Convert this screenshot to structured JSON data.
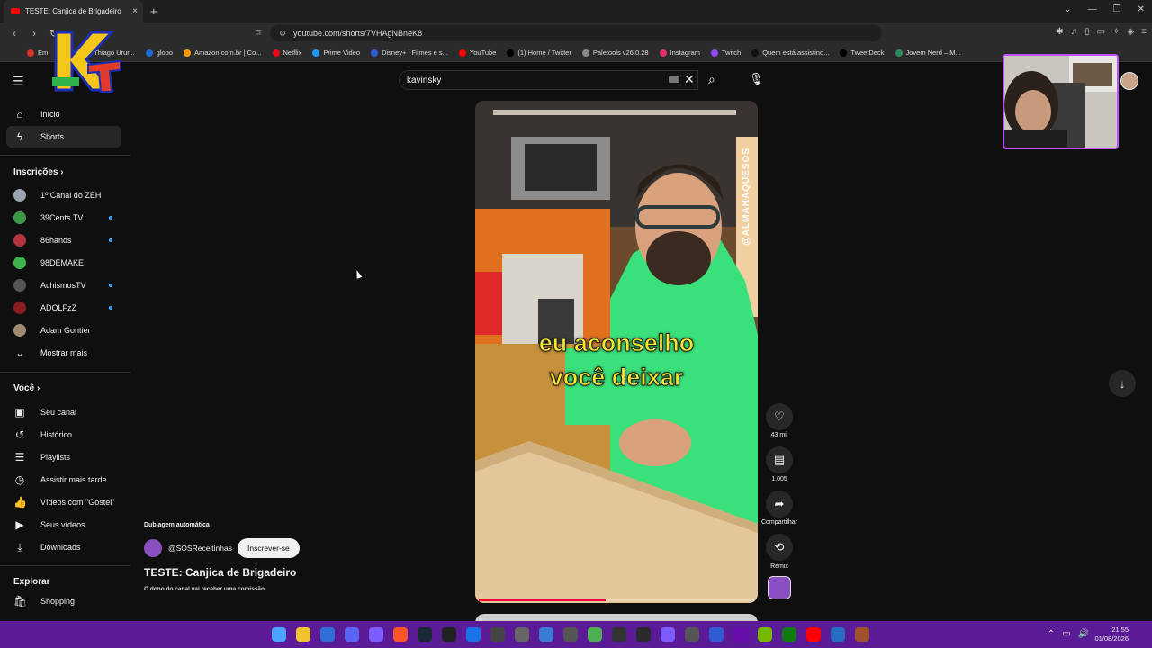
{
  "browser": {
    "tab_title": "TESTE: Canjica de Brigadeiro",
    "tab_close": "×",
    "new_tab": "+",
    "url": "youtube.com/shorts/7VHAgNBneK8",
    "bookmarks": [
      {
        "label": "Em",
        "color": "#d93025"
      },
      {
        "label": "Email – Thiago Urur...",
        "color": "#4285f4"
      },
      {
        "label": "globo",
        "color": "#1e6bd6"
      },
      {
        "label": "Amazon.com.br | Co...",
        "color": "#ff9900"
      },
      {
        "label": "Netflix",
        "color": "#e50914"
      },
      {
        "label": "Prime Video",
        "color": "#1a98ff"
      },
      {
        "label": "Disney+ | Filmes e s...",
        "color": "#2f5bd6"
      },
      {
        "label": "YouTube",
        "color": "#ff0000"
      },
      {
        "label": "(1) Home / Twitter",
        "color": "#000000"
      },
      {
        "label": "Paletools v26.0.28",
        "color": "#888888"
      },
      {
        "label": "Instagram",
        "color": "#e1306c"
      },
      {
        "label": "Twitch",
        "color": "#9146ff"
      },
      {
        "label": "Quem está assistind...",
        "color": "#111111"
      },
      {
        "label": "TweetDeck",
        "color": "#000000"
      },
      {
        "label": "Jovem Nerd – M...",
        "color": "#2d8a5e"
      }
    ]
  },
  "search": {
    "query": "kavinsky"
  },
  "sidebar": {
    "main": [
      {
        "label": "Início",
        "icon": "home-icon",
        "glyph": "⌂"
      },
      {
        "label": "Shorts",
        "icon": "shorts-icon",
        "glyph": "ϟ"
      }
    ],
    "subscriptions_title": "Inscrições",
    "subscriptions": [
      {
        "label": "1º Canal do ZEH",
        "color": "#9aa3ad",
        "new": false
      },
      {
        "label": "39Cents TV",
        "color": "#3c9a45",
        "new": true
      },
      {
        "label": "86hands",
        "color": "#b4343c",
        "new": true
      },
      {
        "label": "98DEMAKE",
        "color": "#39b54a",
        "new": false
      },
      {
        "label": "AchismosTV",
        "color": "#555555",
        "new": true
      },
      {
        "label": "ADOLFzZ",
        "color": "#8b1d22",
        "new": true
      },
      {
        "label": "Adam Gontier",
        "color": "#a08a70",
        "new": false
      }
    ],
    "show_more": "Mostrar mais",
    "you_title": "Você",
    "you": [
      {
        "label": "Seu canal",
        "icon": "channel-icon",
        "glyph": "▣"
      },
      {
        "label": "Histórico",
        "icon": "history-icon",
        "glyph": "↺"
      },
      {
        "label": "Playlists",
        "icon": "playlist-icon",
        "glyph": "☰"
      },
      {
        "label": "Assistir mais tarde",
        "icon": "watch-later-icon",
        "glyph": "◷"
      },
      {
        "label": "Vídeos com \"Gostei\"",
        "icon": "like-icon",
        "glyph": "👍"
      },
      {
        "label": "Seus vídeos",
        "icon": "your-videos-icon",
        "glyph": "▶"
      },
      {
        "label": "Downloads",
        "icon": "download-icon",
        "glyph": "⤓"
      }
    ],
    "explore_title": "Explorar",
    "explore": [
      {
        "label": "Shopping",
        "icon": "shopping-icon",
        "glyph": "🛍"
      }
    ]
  },
  "short": {
    "caption_line1": "eu aconselho",
    "caption_line2": "você deixar",
    "watermark": "@ALMANAQUESOS",
    "progress": 0.46,
    "dub_label": "Dublagem automática",
    "channel": "@SOSReceitinhas",
    "subscribe": "Inscrever-se",
    "title": "TESTE: Canjica de Brigadeiro",
    "commission_note": "O dono do canal vai receber uma comissão"
  },
  "actions": {
    "likes": "43 mil",
    "comments": "1.005",
    "share": "Compartilhar",
    "remix": "Remix"
  },
  "taskbar": {
    "time": "21:55",
    "date": "01/08/2026",
    "icon_colors": [
      "#4aa3ff",
      "#f2c230",
      "#2f6fd6",
      "#5865f2",
      "#7b5cff",
      "#fb542b",
      "#1b2838",
      "#222222",
      "#1a73e8",
      "#444444",
      "#666666",
      "#3a7bd5",
      "#555555",
      "#4caf50",
      "#333333",
      "#2b2b2b",
      "#7a5cff",
      "#555555",
      "#2f5bd6",
      "#6a0dad",
      "#76b900",
      "#107c10",
      "#ff0000",
      "#276dc3",
      "#a0522d"
    ]
  }
}
